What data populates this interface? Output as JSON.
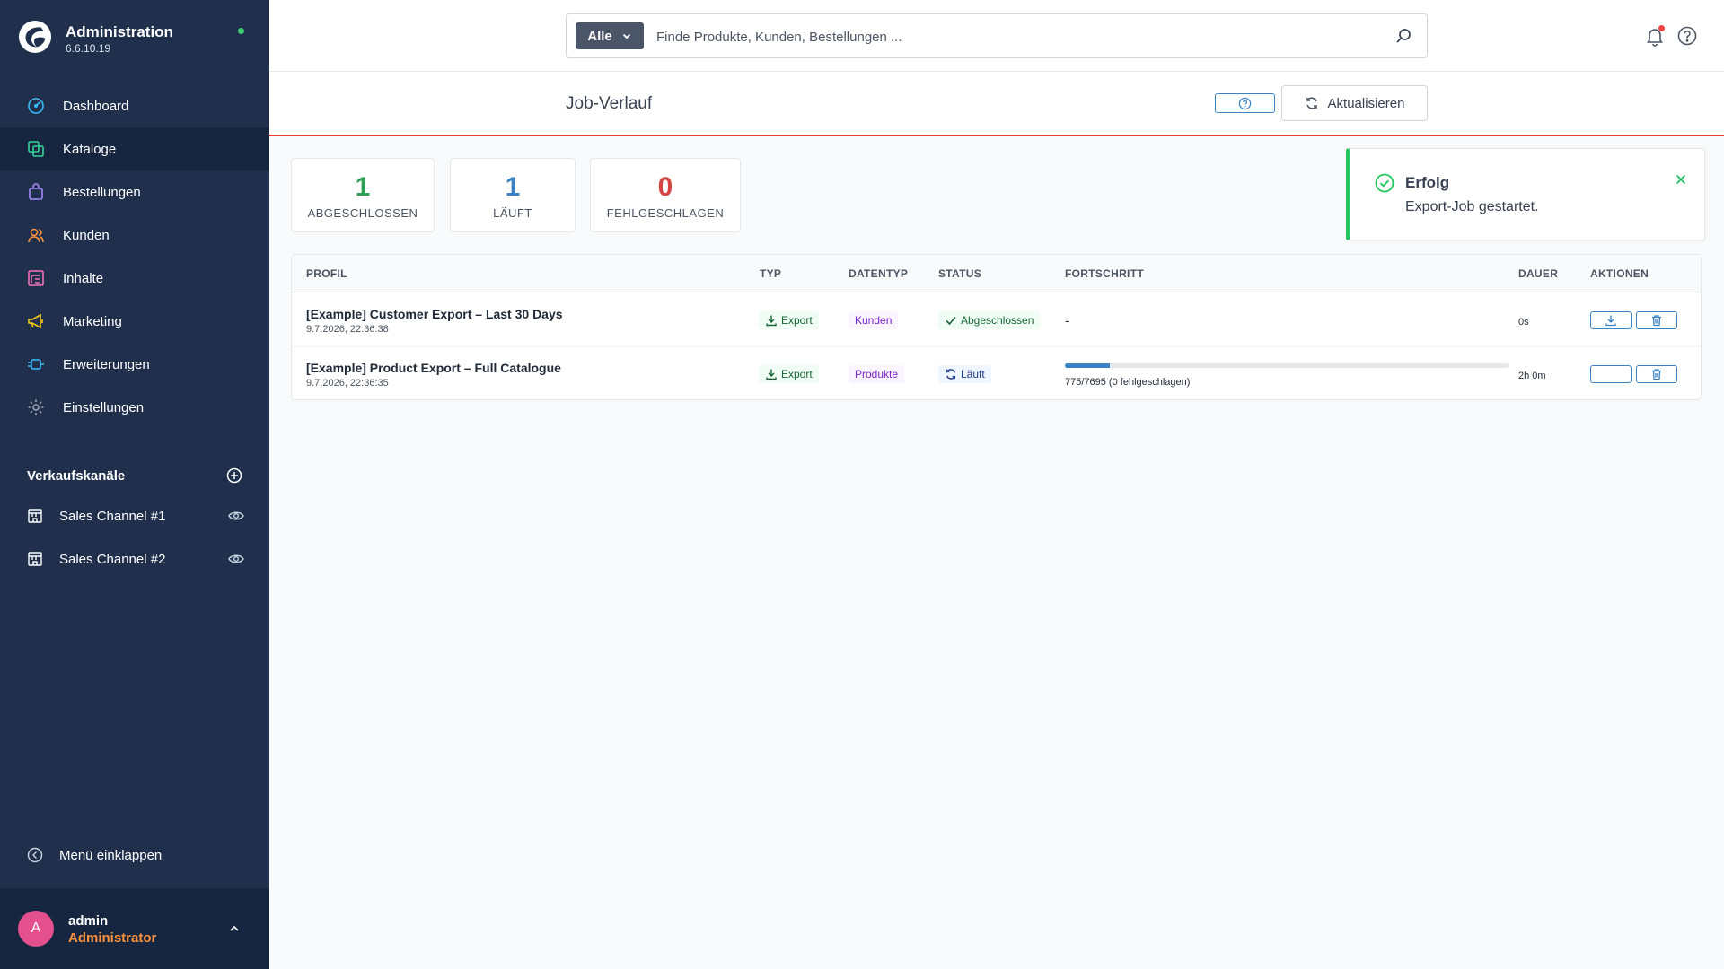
{
  "app": {
    "title": "Administration",
    "version": "6.6.10.19"
  },
  "nav": {
    "items": [
      {
        "label": "Dashboard",
        "icon": "gauge-icon",
        "color": "#38bdf8",
        "active": false
      },
      {
        "label": "Kataloge",
        "icon": "catalog-icon",
        "color": "#34d399",
        "active": true
      },
      {
        "label": "Bestellungen",
        "icon": "bag-icon",
        "color": "#a78bfa",
        "active": false
      },
      {
        "label": "Kunden",
        "icon": "users-icon",
        "color": "#fb923c",
        "active": false
      },
      {
        "label": "Inhalte",
        "icon": "content-icon",
        "color": "#f472b6",
        "active": false
      },
      {
        "label": "Marketing",
        "icon": "megaphone-icon",
        "color": "#facc15",
        "active": false
      },
      {
        "label": "Erweiterungen",
        "icon": "plugin-icon",
        "color": "#38bdf8",
        "active": false
      },
      {
        "label": "Einstellungen",
        "icon": "gear-icon",
        "color": "#9ca3af",
        "active": false
      }
    ],
    "sales_channels_title": "Verkaufskanäle",
    "sales_channels": [
      {
        "label": "Sales Channel #1"
      },
      {
        "label": "Sales Channel #2"
      }
    ],
    "collapse_label": "Menü einklappen"
  },
  "user": {
    "initial": "A",
    "name": "admin",
    "role": "Administrator"
  },
  "search": {
    "filter_label": "Alle",
    "placeholder": "Finde Produkte, Kunden, Bestellungen ..."
  },
  "page": {
    "title": "Job-Verlauf",
    "refresh_label": "Aktualisieren"
  },
  "stats": [
    {
      "value": "1",
      "label": "ABGESCHLOSSEN",
      "color": "#2f9e57"
    },
    {
      "value": "1",
      "label": "LÄUFT",
      "color": "#3b82c4"
    },
    {
      "value": "0",
      "label": "FEHLGESCHLAGEN",
      "color": "#d64545"
    }
  ],
  "toast": {
    "title": "Erfolg",
    "message": "Export-Job gestartet.",
    "color": "#22c55e"
  },
  "table": {
    "headers": [
      "PROFIL",
      "TYP",
      "DATENTYP",
      "STATUS",
      "FORTSCHRITT",
      "DAUER",
      "AKTIONEN"
    ],
    "rows": [
      {
        "profile": "[Example] Customer Export – Last 30 Days",
        "date": "9.7.2026, 22:36:38",
        "type": "Export",
        "datatype": "Kunden",
        "status": "Abgeschlossen",
        "progress_text": "-",
        "duration": "0s"
      },
      {
        "profile": "[Example] Product Export – Full Catalogue",
        "date": "9.7.2026, 22:36:35",
        "type": "Export",
        "datatype": "Produkte",
        "status": "Läuft",
        "progress_text": "775/7695 (0 fehlgeschlagen)",
        "progress_fraction": 0.1007,
        "duration": "2h 0m"
      }
    ]
  }
}
